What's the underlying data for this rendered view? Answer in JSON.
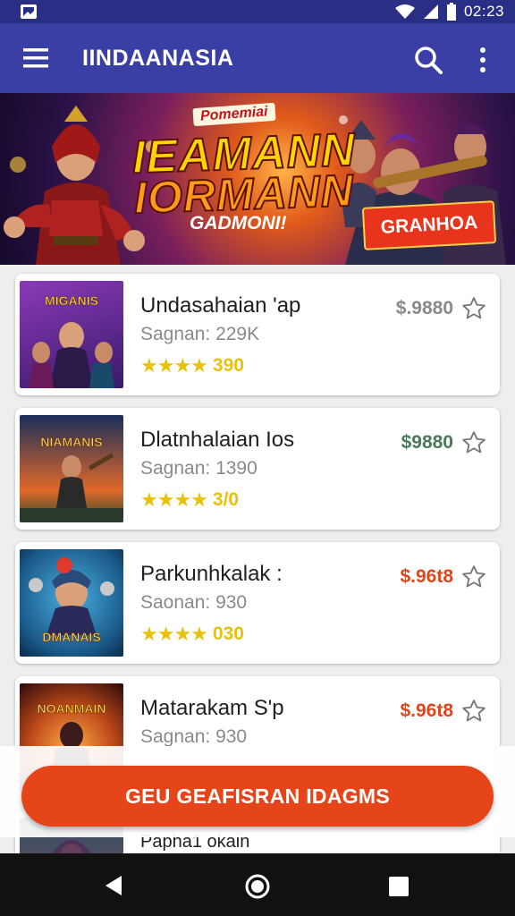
{
  "status_bar": {
    "time": "02:23",
    "icons": [
      "image-icon",
      "wifi-icon",
      "signal-icon",
      "battery-icon"
    ]
  },
  "app_bar": {
    "title": "IINDAANASIA",
    "icons": [
      "menu-icon",
      "search-icon",
      "more-vertical-icon"
    ]
  },
  "banner": {
    "tagline": "Pomemiai",
    "headline_line1": "IEAMANN",
    "headline_line2": "IORMANN",
    "subtitle": "GADMONI!",
    "button_label": "GRANHOA"
  },
  "list": {
    "items": [
      {
        "title": "Undasahaian 'ap",
        "subtitle": "Sagnan: 229K",
        "rating_stars": "★★★★",
        "rating_value": "390",
        "price": "$.9880",
        "price_color": "#8a8a8a",
        "thumb_title": "MIGANIS",
        "thumb_bg": "#5a2a8a",
        "icon": "star-outline-icon"
      },
      {
        "title": "Dlatnhalaian Ios",
        "subtitle": "Sagnan: 1390",
        "rating_stars": "★★★★",
        "rating_value": "3/0",
        "price": "$9880",
        "price_color": "#4a7a5a",
        "thumb_title": "NIAMANIS",
        "thumb_bg": "#1e3a6a",
        "icon": "star-outline-icon"
      },
      {
        "title": "Parkunhkalak :",
        "subtitle": "Saonan: 930",
        "rating_stars": "★★★★",
        "rating_value": "030",
        "price": "$.96t8",
        "price_color": "#e0451c",
        "thumb_title": "DMANAIS",
        "thumb_bg": "#1a6a9a",
        "icon": "star-outline-icon"
      },
      {
        "title": "Matarakam S'p",
        "subtitle": "Sagnan: 930",
        "rating_stars": "",
        "rating_value": "",
        "price": "$.96t8",
        "price_color": "#e0451c",
        "thumb_title": "NOANMAIN",
        "thumb_bg": "#5a1a1a",
        "icon": "star-outline-icon"
      }
    ],
    "partial_item_title": "Papha1 okain"
  },
  "cta": {
    "label": "GEU GEAFISRAN IDAGMS"
  },
  "nav_bar": {
    "icons": [
      "back-icon",
      "home-icon",
      "recents-icon"
    ]
  }
}
